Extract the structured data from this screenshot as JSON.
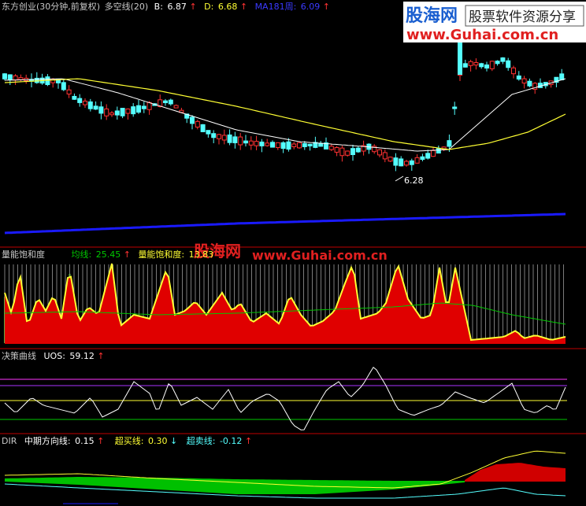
{
  "header": {
    "title": "东方创业(30分钟,前复权)",
    "indicator": "多空线(20)",
    "b_label": "B:",
    "b_value": "6.87",
    "d_label": "D:",
    "d_value": "6.68",
    "ma_label": "MA181周:",
    "ma_value": "6.09",
    "low_marker": "6.28"
  },
  "watermark": {
    "logo": "股海网",
    "tagline": "股票软件资源分享",
    "url": "www.Guhai.com.cn",
    "mid_logo": "股海网",
    "mid_url": "www.Guhai.com.cn"
  },
  "panel2": {
    "name": "量能饱和度",
    "avg_label": "均线:",
    "avg_value": "25.45",
    "sat_label": "量能饱和度:",
    "sat_value": "13.83"
  },
  "panel3": {
    "name": "决策曲线",
    "uos_label": "UOS:",
    "uos_value": "59.12"
  },
  "panel4": {
    "name": "DIR",
    "mid_label": "中期方向线:",
    "mid_value": "0.15",
    "over_buy_label": "超买线:",
    "over_buy_value": "0.30",
    "over_sell_label": "超卖线:",
    "over_sell_value": "-0.12"
  },
  "colors": {
    "up": "#ff3232",
    "down": "#54ffff",
    "yellow": "#ffff33",
    "white": "#ffffff",
    "blue": "#1a1aff",
    "green": "#00c800",
    "magenta": "#ff33ff",
    "divider": "#c00000"
  }
}
